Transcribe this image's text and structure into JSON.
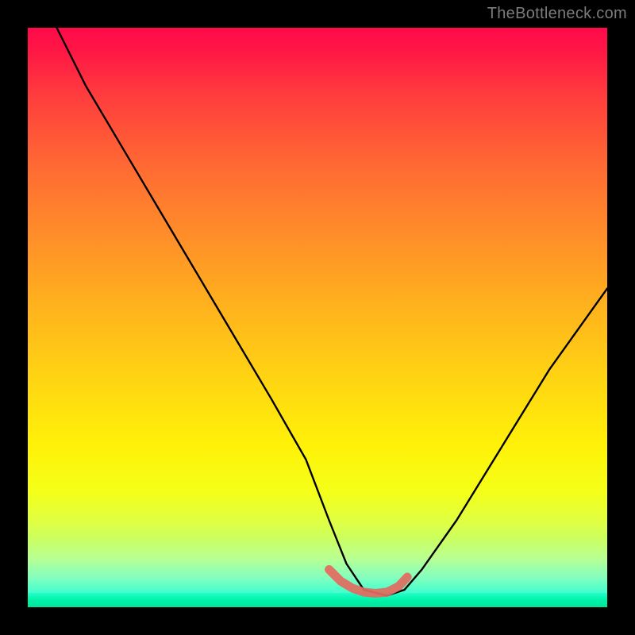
{
  "watermark": "TheBottleneck.com",
  "colors": {
    "frame": "#000000",
    "curve": "#000000",
    "marker": "#e46a5e",
    "gradient_top": "#ff0a4a",
    "gradient_bottom": "#00e69a"
  },
  "chart_data": {
    "type": "line",
    "title": "",
    "xlabel": "",
    "ylabel": "",
    "xlim": [
      0,
      100
    ],
    "ylim": [
      0,
      100
    ],
    "grid": false,
    "legend": false,
    "description": "Bottleneck-style V-curve over vertical rainbow gradient. Y≈100 is worst (red, top), Y≈0 is best (green, bottom). Left branch descends steeply from top-left corner to a flat floor near x≈55–65, then right branch rises with shallower slope toward top-right edge, reaching about y≈55 at x=100.",
    "series": [
      {
        "name": "bottleneck-curve",
        "x": [
          5,
          10,
          18,
          26,
          34,
          42,
          48,
          52,
          55,
          58,
          62,
          65,
          68,
          74,
          82,
          90,
          100
        ],
        "y": [
          100,
          90,
          76.5,
          63,
          49.5,
          36,
          25.5,
          15,
          7.5,
          3,
          2,
          3,
          6.5,
          15,
          28,
          41,
          55
        ]
      },
      {
        "name": "floor-marker",
        "x": [
          52,
          54,
          56,
          58,
          60,
          62,
          64,
          65.5
        ],
        "y": [
          6.5,
          4.5,
          3.3,
          2.6,
          2.4,
          2.6,
          3.6,
          5.2
        ]
      }
    ]
  }
}
